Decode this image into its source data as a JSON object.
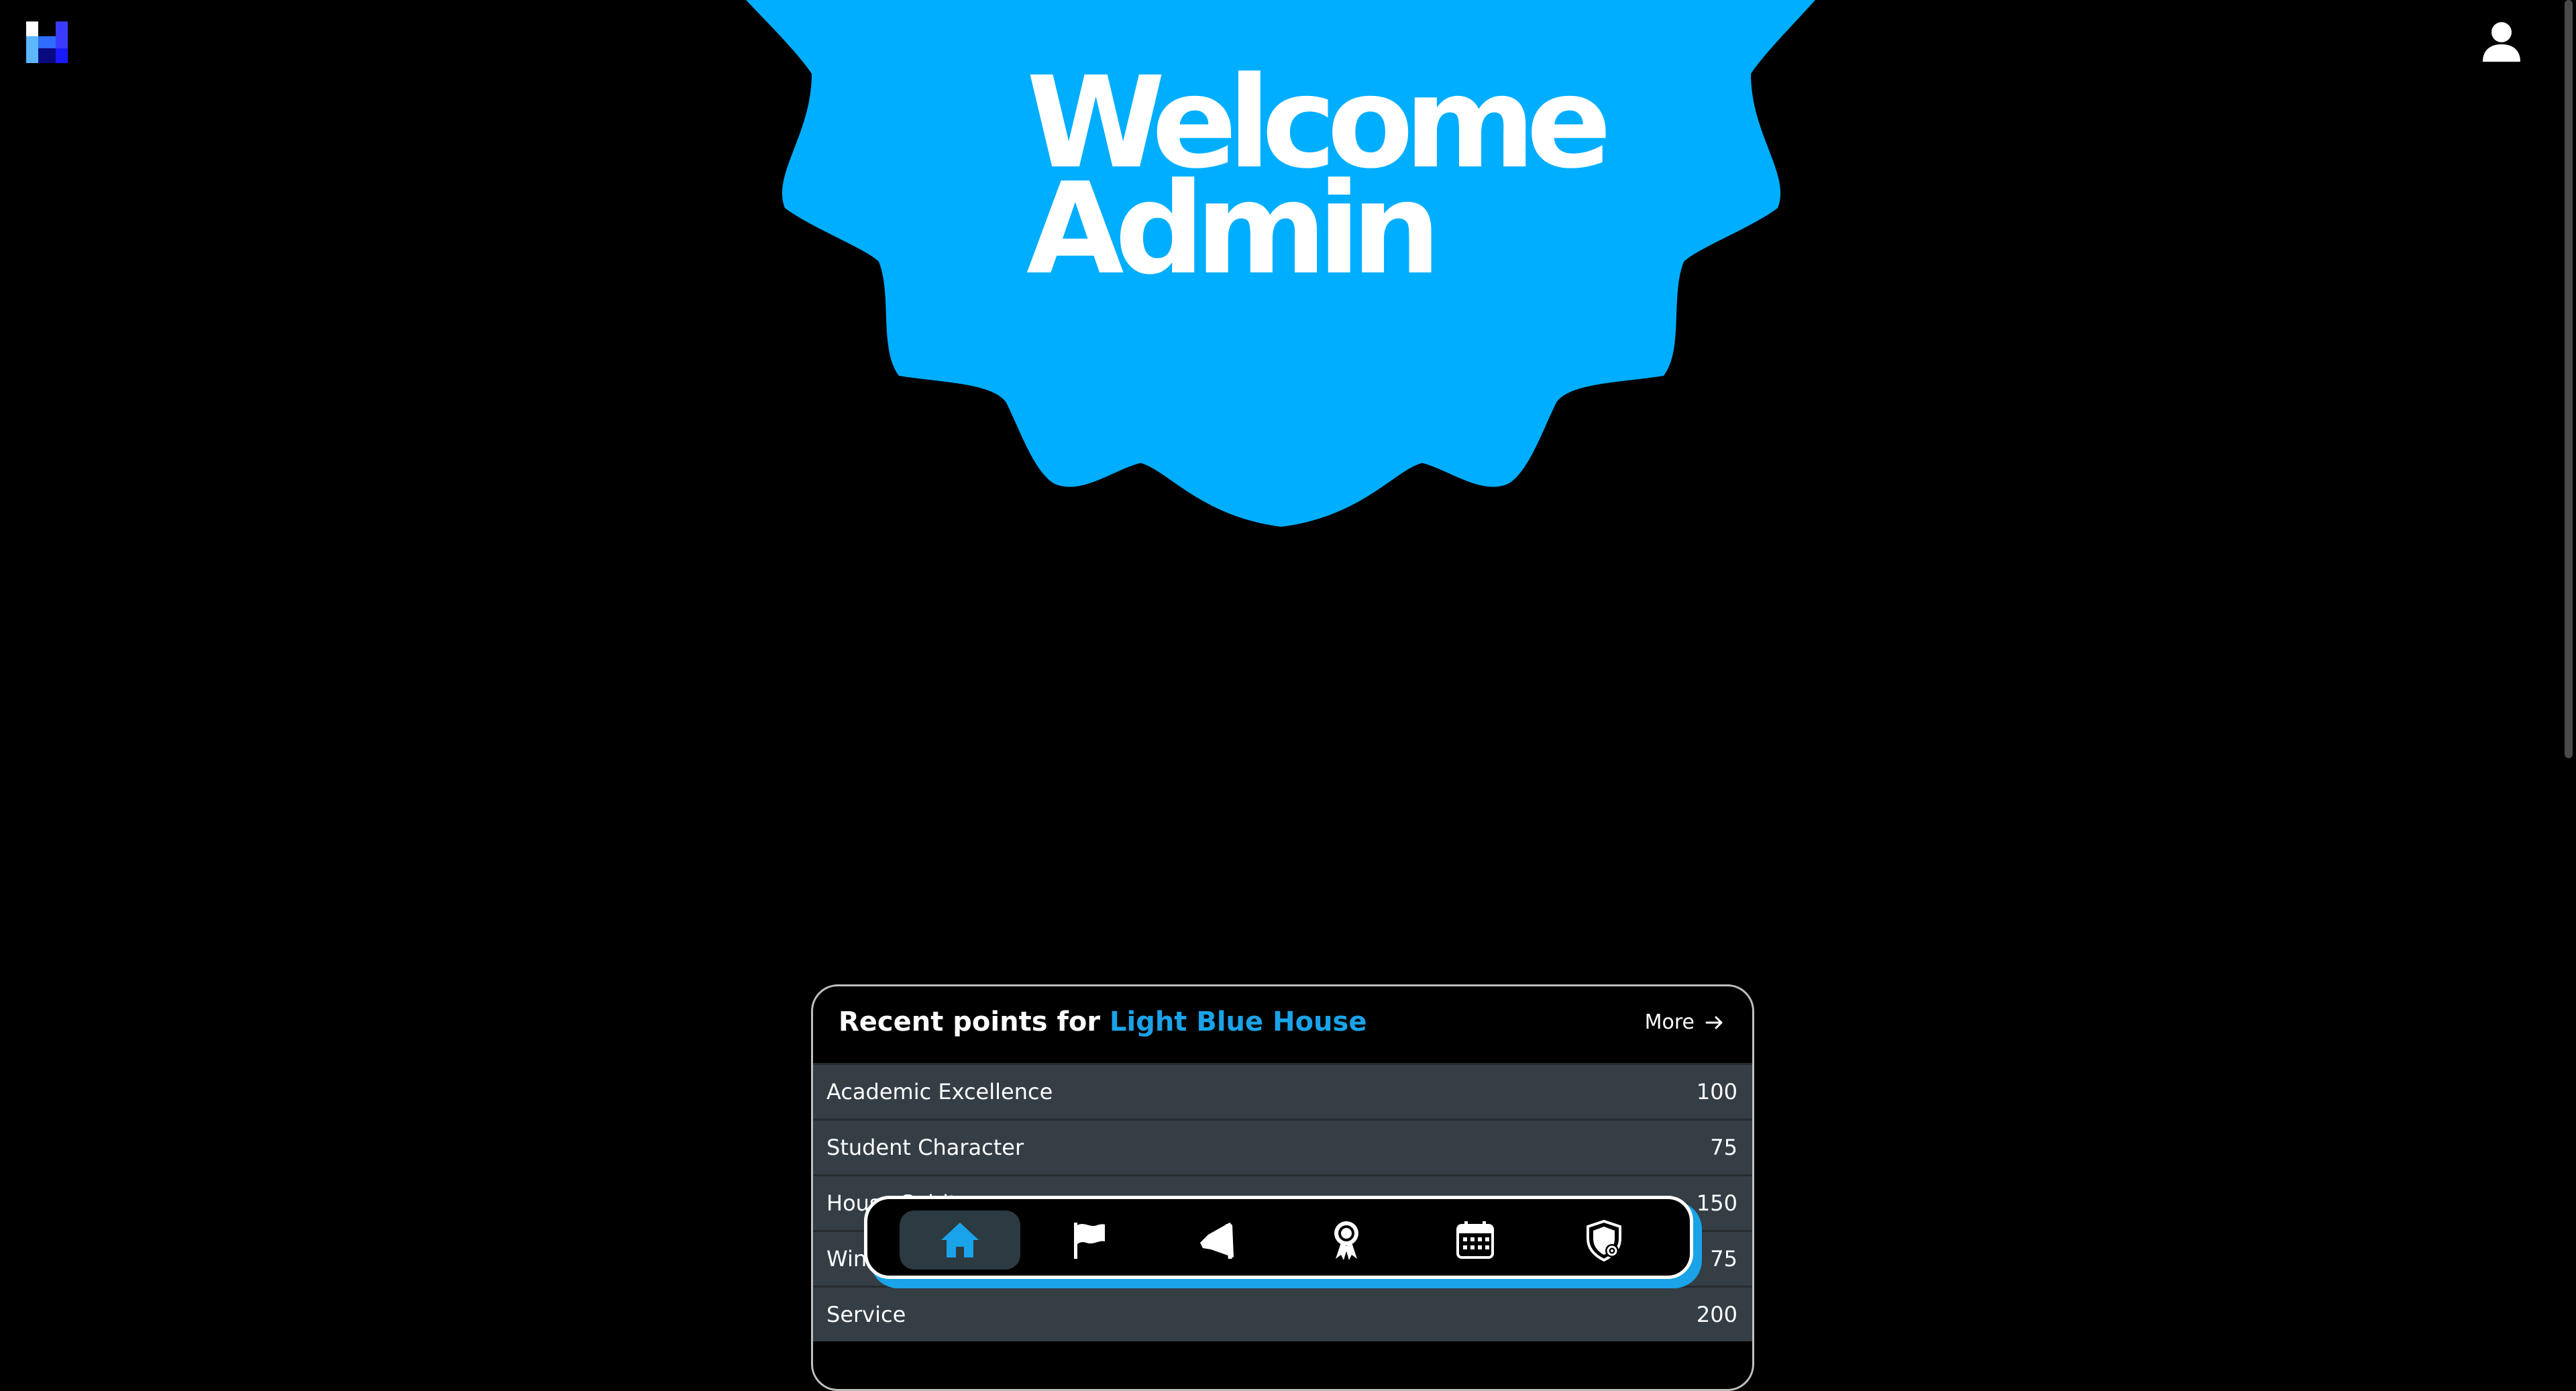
{
  "app": {
    "logo": "H",
    "logo_icon": "house-points-logo",
    "profile_icon": "user-icon"
  },
  "hero": {
    "line1": "Welcome",
    "line2": "Admin",
    "badge_color": "#00aeff"
  },
  "recent_points": {
    "title_prefix": "Recent points for",
    "house_name": "Light Blue House",
    "house_color": "#1aa3e8",
    "more_label": "More",
    "rows": [
      {
        "category": "Academic Excellence",
        "points": "100"
      },
      {
        "category": "Student Character",
        "points": "75"
      },
      {
        "category": "House Spirit",
        "points": "150"
      },
      {
        "category": "Winners",
        "points": "75"
      },
      {
        "category": "Service",
        "points": "200"
      }
    ]
  },
  "nav": {
    "items": [
      {
        "name": "home",
        "icon": "home-icon",
        "active": true
      },
      {
        "name": "houses",
        "icon": "flag-icon",
        "active": false
      },
      {
        "name": "announcements",
        "icon": "megaphone-icon",
        "active": false
      },
      {
        "name": "awards",
        "icon": "award-ribbon-icon",
        "active": false
      },
      {
        "name": "events",
        "icon": "calendar-icon",
        "active": false
      },
      {
        "name": "admin",
        "icon": "shield-icon",
        "active": false
      }
    ],
    "accent": "#1aa3e8"
  }
}
